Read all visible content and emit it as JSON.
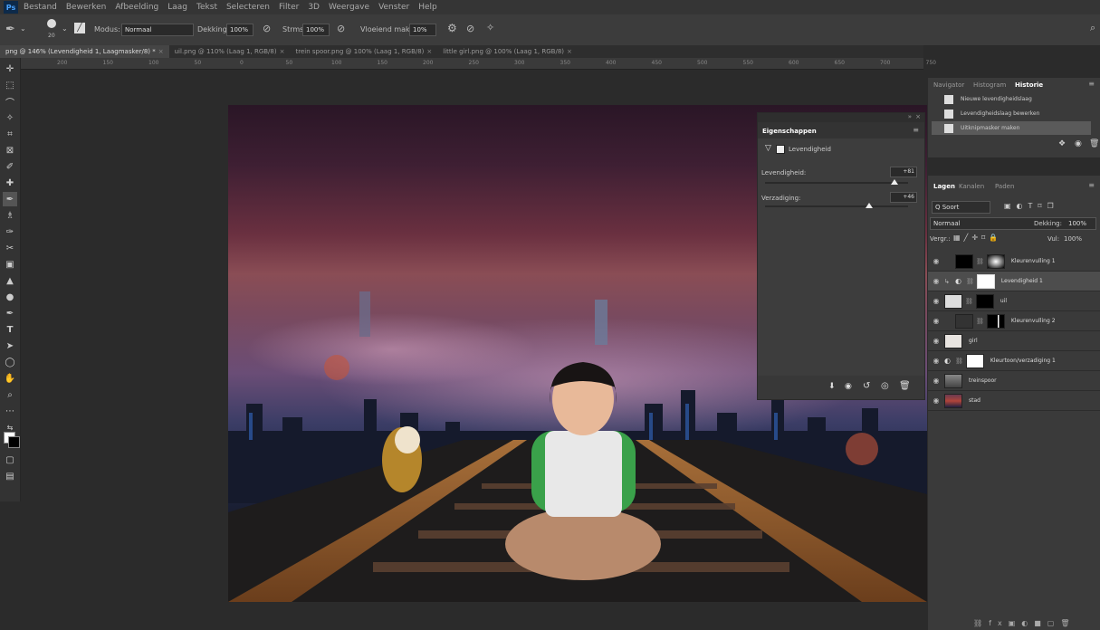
{
  "menu": [
    "Bestand",
    "Bewerken",
    "Afbeelding",
    "Laag",
    "Tekst",
    "Selecteren",
    "Filter",
    "3D",
    "Weergave",
    "Venster",
    "Help"
  ],
  "app_logo": "Ps",
  "options": {
    "brush_size": "20",
    "modus_label": "Modus:",
    "modus_value": "Normaal",
    "dekking_label": "Dekking:",
    "dekking_value": "100%",
    "sterkte_label": "Strms:",
    "sterkte_value": "100%",
    "vloeiend_label": "Vloeiend maken:",
    "vloeiend_value": "10%"
  },
  "tabs": [
    {
      "label": "png @ 146% (Levendigheid 1, Laagmasker/8) *"
    },
    {
      "label": "uil.png @ 110% (Laag 1, RGB/8)"
    },
    {
      "label": "trein spoor.png @ 100% (Laag 1, RGB/8)"
    },
    {
      "label": "little girl.png @ 100% (Laag 1, RGB/8)"
    }
  ],
  "ruler_ticks": [
    "200",
    "150",
    "100",
    "50",
    "0",
    "50",
    "100",
    "150",
    "200",
    "250",
    "300",
    "350",
    "400",
    "450",
    "500",
    "550",
    "600",
    "650",
    "700",
    "750"
  ],
  "properties": {
    "title": "Eigenschappen",
    "layer_type": "Levendigheid",
    "vibrance_label": "Levendigheid:",
    "vibrance_value": "+81",
    "vibrance_level": 0.905,
    "saturation_label": "Verzadiging:",
    "saturation_value": "+46",
    "saturation_level": 0.73
  },
  "right_panel": {
    "tabs": [
      "Navigator",
      "Histogram",
      "Historie"
    ],
    "history": [
      {
        "label": "Nieuwe levendigheidslaag"
      },
      {
        "label": "Levendigheidslaag bewerken"
      },
      {
        "label": "Uitknipmasker maken"
      }
    ]
  },
  "layers_panel": {
    "tabs": [
      "Lagen",
      "Kanalen",
      "Paden"
    ],
    "filter_label": "Q Soort",
    "blend_mode": "Normaal",
    "dekking_label": "Dekking:",
    "dekking_value": "100%",
    "lock_label": "Vergr.:",
    "fill_label": "Vul:",
    "fill_value": "100%",
    "layers": [
      {
        "name": "Kleurenvulling 1"
      },
      {
        "name": "Levendigheid 1"
      },
      {
        "name": "uil"
      },
      {
        "name": "Kleurenvulling 2"
      },
      {
        "name": "girl"
      },
      {
        "name": "Kleurtoon/verzadiging 1"
      },
      {
        "name": "treinspoor"
      },
      {
        "name": "stad"
      }
    ]
  }
}
